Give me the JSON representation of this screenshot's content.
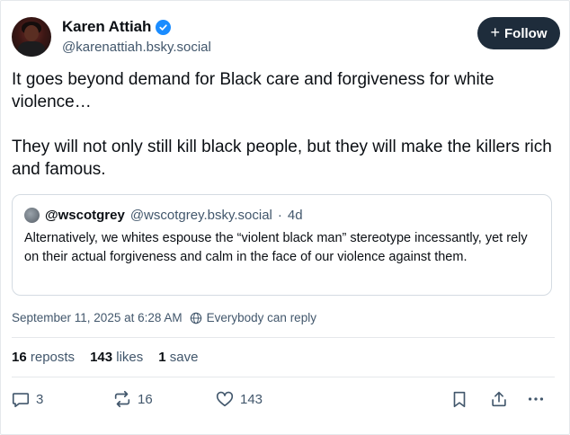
{
  "author": {
    "display_name": "Karen Attiah",
    "handle": "@karenattiah.bsky.social",
    "verified_icon": "verified-check-icon"
  },
  "follow_button": {
    "icon": "plus-icon",
    "label": "Follow"
  },
  "post": {
    "paragraphs": [
      "It goes beyond demand for Black care and forgiveness for white violence…",
      "They will not only still kill black people, but they will make the killers rich and famous."
    ]
  },
  "quote": {
    "avatar_icon": "quote-avatar-icon",
    "name": "@wscotgrey",
    "handle": "@wscotgrey.bsky.social",
    "separator": "·",
    "age": "4d",
    "text": "Alternatively, we whites espouse the “violent black man” stereotype incessantly, yet rely on their actual forgiveness and calm in the face of our violence against them."
  },
  "meta": {
    "timestamp": "September 11, 2025 at 6:28 AM",
    "reply_setting_icon": "globe-icon",
    "reply_setting": "Everybody can reply"
  },
  "stats": {
    "reposts_count": "16",
    "reposts_label": "reposts",
    "likes_count": "143",
    "likes_label": "likes",
    "saves_count": "1",
    "saves_label": "save"
  },
  "actions": {
    "reply_count": "3",
    "repost_count": "16",
    "like_count": "143",
    "icons": [
      "reply-icon",
      "repost-icon",
      "like-icon",
      "bookmark-icon",
      "share-icon",
      "more-icon"
    ]
  },
  "colors": {
    "text": "#0b0f14",
    "muted": "#42576c",
    "follow_bg": "#1e2c3b",
    "verified": "#1a8cff",
    "border": "#e5e8eb"
  }
}
